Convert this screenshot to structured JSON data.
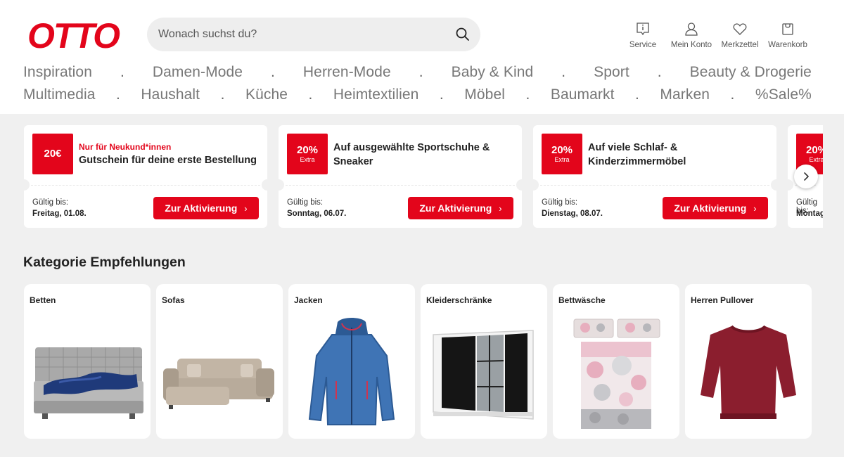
{
  "brand": {
    "logo_text": "OTTO",
    "color": "#e3051b"
  },
  "search": {
    "placeholder": "Wonach suchst du?"
  },
  "header_actions": [
    {
      "label": "Service",
      "icon": "service-icon"
    },
    {
      "label": "Mein Konto",
      "icon": "user-icon"
    },
    {
      "label": "Merkzettel",
      "icon": "heart-icon"
    },
    {
      "label": "Warenkorb",
      "icon": "cart-icon"
    }
  ],
  "nav": {
    "separator": ".",
    "row1": [
      "Inspiration",
      "Damen-Mode",
      "Herren-Mode",
      "Baby & Kind",
      "Sport",
      "Beauty & Drogerie"
    ],
    "row2": [
      "Multimedia",
      "Haushalt",
      "Küche",
      "Heimtextilien",
      "Möbel",
      "Baumarkt",
      "Marken",
      "%Sale%"
    ]
  },
  "coupons": [
    {
      "badge_big": "20€",
      "badge_small": "",
      "eyebrow": "Nur für Neukund*innen",
      "title": "Gutschein für deine erste Bestellung",
      "valid_label": "Gültig bis:",
      "valid_date": "Freitag, 01.08.",
      "cta": "Zur Aktivierung"
    },
    {
      "badge_big": "20%",
      "badge_small": "Extra",
      "eyebrow": "",
      "title": "Auf ausgewählte Sportschuhe & Sneaker",
      "valid_label": "Gültig bis:",
      "valid_date": "Sonntag, 06.07.",
      "cta": "Zur Aktivierung"
    },
    {
      "badge_big": "20%",
      "badge_small": "Extra",
      "eyebrow": "",
      "title": "Auf viele Schlaf- & Kinderzimmermöbel",
      "valid_label": "Gültig bis:",
      "valid_date": "Dienstag, 08.07.",
      "cta": "Zur Aktivierung"
    },
    {
      "badge_big": "20%",
      "badge_small": "Extra",
      "eyebrow": "",
      "title": "",
      "valid_label": "Gültig bis:",
      "valid_date": "Montag",
      "cta": ""
    }
  ],
  "categories_section": {
    "title": "Kategorie Empfehlungen",
    "items": [
      {
        "label": "Betten",
        "image": "bed-image"
      },
      {
        "label": "Sofas",
        "image": "sofa-image"
      },
      {
        "label": "Jacken",
        "image": "jacket-image"
      },
      {
        "label": "Kleiderschränke",
        "image": "wardrobe-image"
      },
      {
        "label": "Bettwäsche",
        "image": "bedding-image"
      },
      {
        "label": "Herren Pullover",
        "image": "sweater-image"
      }
    ]
  }
}
